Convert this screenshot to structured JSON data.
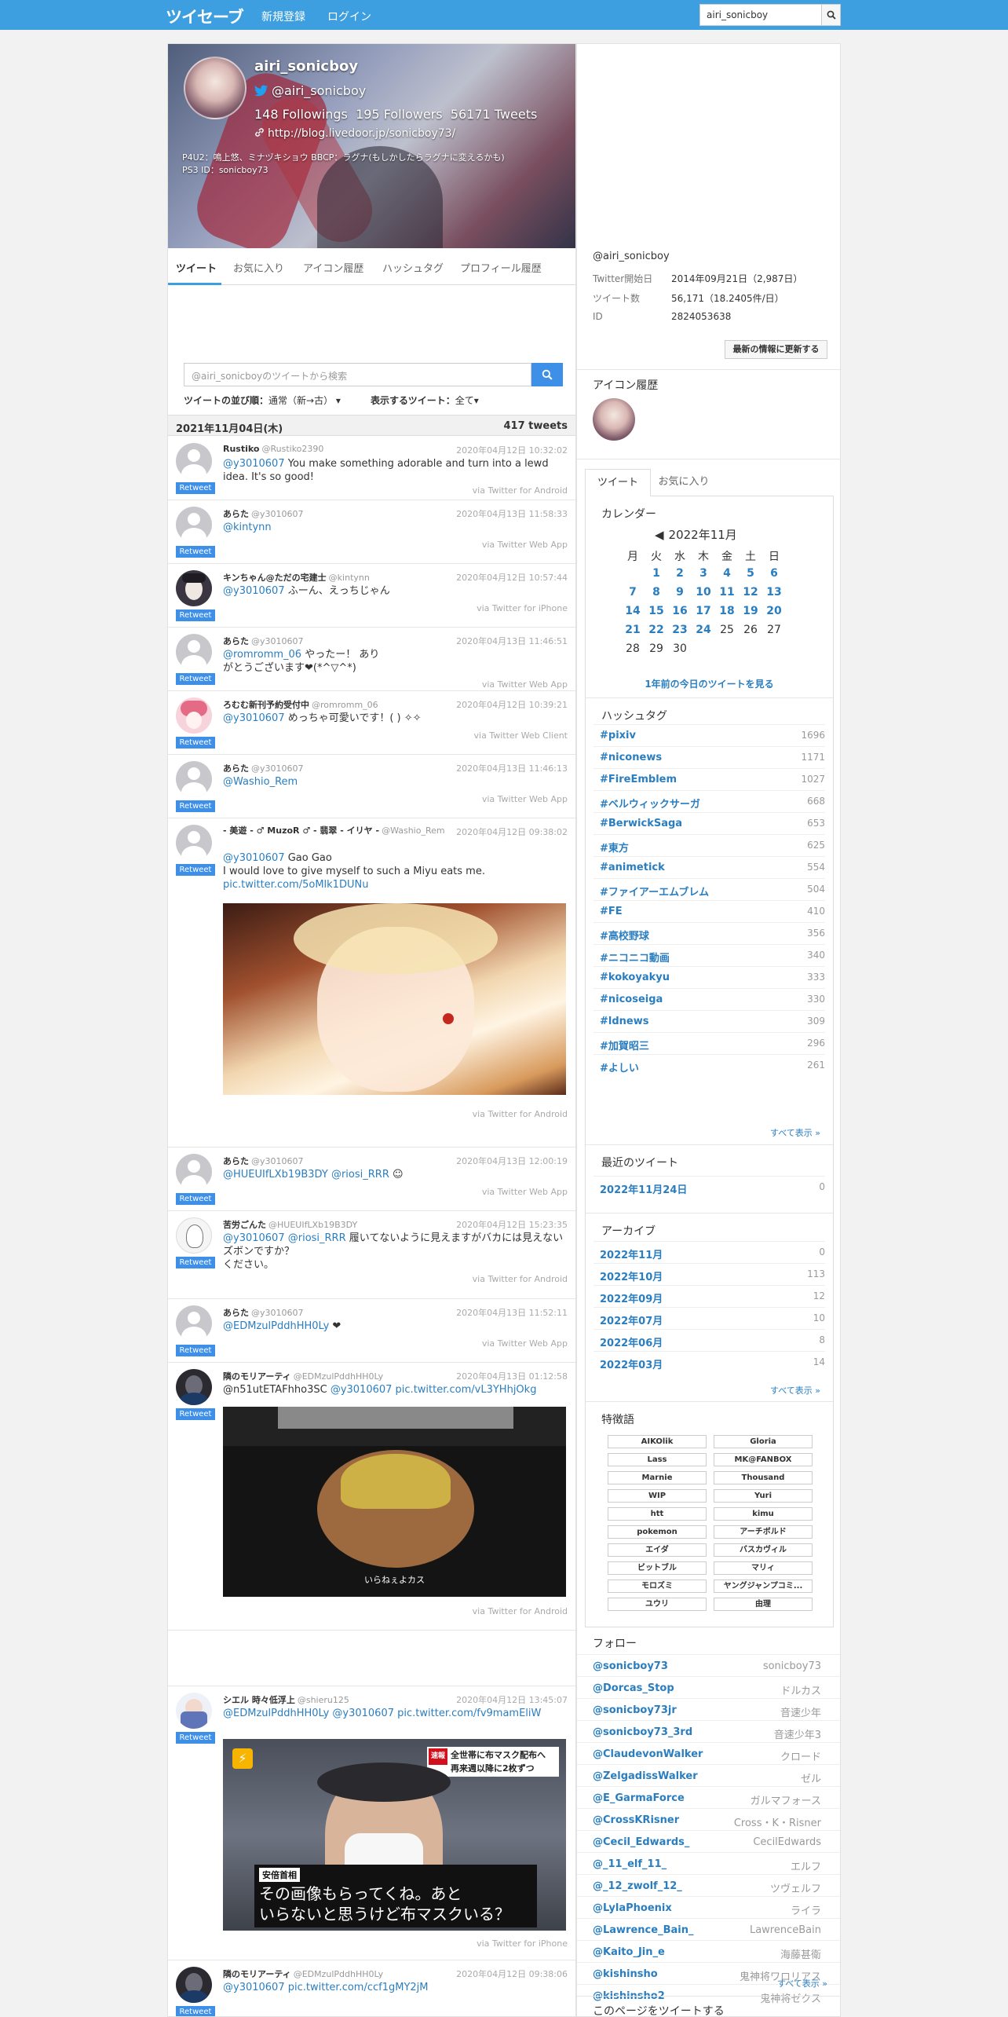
{
  "header": {
    "logo": "ツイセーブ",
    "signup": "新規登録",
    "login": "ログイン",
    "search_value": "airi_sonicboy"
  },
  "profile": {
    "name": "airi_sonicboy",
    "handle": "@airi_sonicboy",
    "stats": "148 Followings  195 Followers  56171 Tweets",
    "url": "http://blog.livedoor.jp/sonicboy73/",
    "bio1": "P4U2：鳴上悠、ミナヅキショウ BBCP：ラグナ(もしかしたらラグナに変えるかも)",
    "bio2": "PS3 ID：sonicboy73"
  },
  "tabs": [
    "ツイート",
    "お気に入り",
    "アイコン履歴",
    "ハッシュタグ",
    "プロフィール履歴"
  ],
  "timeline": {
    "search_placeholder": "@airi_sonicboyのツイートから検索",
    "sort_label": "ツイートの並び順：",
    "sort_value": "通常（新→古）",
    "show_label": "表示するツイート：",
    "show_value": "全て",
    "date": "2021年11月04日(木)",
    "count": "417 tweets"
  },
  "retweet_label": "Retweet",
  "tweets": [
    {
      "name": "Rustiko",
      "sn": "@Rustiko2390",
      "time": "2020年04月12日 10:32:02",
      "link": "@y3010607",
      "text": " You make something adorable and turn into a lewd idea. It's so good!",
      "via": "via Twitter for Android"
    },
    {
      "name": "あらた",
      "sn": "@y3010607",
      "time": "2020年04月13日 11:58:33",
      "link": "@kintynn",
      "text": " ",
      "via": "via Twitter Web App"
    },
    {
      "name": "キンちゃん@ただの宅建士",
      "sn": "@kintynn",
      "time": "2020年04月12日 10:57:44",
      "link": "@y3010607",
      "text": " ふーん、えっちじゃん",
      "via": "via Twitter for iPhone"
    },
    {
      "name": "あらた",
      "sn": "@y3010607",
      "time": "2020年04月13日 11:46:51",
      "link": "@romromm_06",
      "text": " やったー！ ありがとうございます❤(*^▽^*)",
      "via": "via Twitter Web App"
    },
    {
      "name": "ろむむ新刊予約受付中",
      "sn": "@romromm_06",
      "time": "2020年04月12日 10:39:21",
      "link": "@y3010607",
      "text": " めっちゃ可愛いです！( ) ✧✧",
      "via": "via Twitter Web Client"
    },
    {
      "name": "あらた",
      "sn": "@y3010607",
      "time": "2020年04月13日 11:46:13",
      "link": "@Washio_Rem",
      "text": " ",
      "via": "via Twitter Web App"
    },
    {
      "name": "- 美遊 - ♂ MuzoR ♂ - 翡翠 - イリヤ -",
      "sn": "@Washio_Rem",
      "time": "2020年04月12日 09:38:02",
      "link": "@y3010607",
      "text": " Gao Gao",
      "text2": "I would love to give myself to such a Miyu eats me. ",
      "link2": "pic.twitter.com/5oMlk1DUNu",
      "via": "via Twitter for Android"
    },
    {
      "name": "あらた",
      "sn": "@y3010607",
      "time": "2020年04月13日 12:00:19",
      "link": "@HUEUIfLXb19B3DY",
      "link2": "@riosi_RRR",
      "text": " ☺",
      "via": "via Twitter Web App"
    },
    {
      "name": "苦労ごんた",
      "sn": "@HUEUIfLXb19B3DY",
      "time": "2020年04月12日 15:23:35",
      "link": "@y3010607",
      "link2": "@riosi_RRR",
      "text": " 履いてないように見えますがバカには見えないズボンですか？",
      "text2": "ください。",
      "via": "via Twitter for Android"
    },
    {
      "name": "あらた",
      "sn": "@y3010607",
      "time": "2020年04月13日 11:52:11",
      "link": "@EDMzulPddhHH0Ly",
      "text": " ❤",
      "via": "via Twitter Web App"
    },
    {
      "name": "隣のモリアーティ",
      "sn": "@EDMzulPddhHH0Ly",
      "time": "2020年04月13日 01:12:58",
      "text": "@n51utETAFhho3SC ",
      "link": "@y3010607",
      "link2": "pic.twitter.com/vL3YHhjOkg",
      "caption": "いらねぇよカス",
      "via": "via Twitter for Android"
    },
    {
      "name": "シエル 時々低浮上",
      "sn": "@shieru125",
      "time": "2020年04月12日 13:45:07",
      "link": "@EDMzulPddhHH0Ly",
      "link2": "@y3010607",
      "link3": "pic.twitter.com/fv9mamEliW",
      "news_tag": "速報",
      "news_head1": "全世帯に布マスク配布へ",
      "news_head2": "再来週以降に2枚ずつ",
      "news_name": "安倍首相",
      "news_sub1": "その画像もらってくね。あと",
      "news_sub2": "いらないと思うけど布マスクいる？",
      "via": "via Twitter for iPhone"
    },
    {
      "name": "隣のモリアーティ",
      "sn": "@EDMzulPddhHH0Ly",
      "time": "2020年04月12日 09:38:06",
      "link": "@y3010607",
      "link2": "pic.twitter.com/ccf1gMY2jM"
    }
  ],
  "side": {
    "handle": "@airi_sonicboy",
    "info": [
      {
        "k": "Twitter開始日",
        "v": "2014年09月21日（2,987日）"
      },
      {
        "k": "ツイート数",
        "v": "56,171（18.2405件/日）"
      },
      {
        "k": "ID",
        "v": "2824053638"
      }
    ],
    "update_btn": "最新の情報に更新する",
    "icon_title": "アイコン履歴",
    "tabs": [
      "ツイート",
      "お気に入り"
    ],
    "cal_title": "カレンダー",
    "cal_month": "2022年11月",
    "cal_days": [
      "月",
      "火",
      "水",
      "木",
      "金",
      "土",
      "日"
    ],
    "cal_link": "1年前の今日のツイートを見る",
    "hash_title": "ハッシュタグ",
    "hashtags": [
      {
        "k": "#pixiv",
        "v": "1696"
      },
      {
        "k": "#niconews",
        "v": "1171"
      },
      {
        "k": "#FireEmblem",
        "v": "1027"
      },
      {
        "k": "#ベルウィックサーガ",
        "v": "668"
      },
      {
        "k": "#BerwickSaga",
        "v": "653"
      },
      {
        "k": "#東方",
        "v": "625"
      },
      {
        "k": "#animetick",
        "v": "554"
      },
      {
        "k": "#ファイアーエムブレム",
        "v": "504"
      },
      {
        "k": "#FE",
        "v": "410"
      },
      {
        "k": "#高校野球",
        "v": "356"
      },
      {
        "k": "#ニコニコ動画",
        "v": "340"
      },
      {
        "k": "#kokoyakyu",
        "v": "333"
      },
      {
        "k": "#nicoseiga",
        "v": "330"
      },
      {
        "k": "#ldnews",
        "v": "309"
      },
      {
        "k": "#加賀昭三",
        "v": "296"
      },
      {
        "k": "#よしい",
        "v": "261"
      }
    ],
    "more": "すべて表示 »",
    "recent_title": "最近のツイート",
    "recent": [
      {
        "k": "2022年11月24日",
        "v": "0"
      }
    ],
    "archive_title": "アーカイブ",
    "archive": [
      {
        "k": "2022年11月",
        "v": "0"
      },
      {
        "k": "2022年10月",
        "v": "113"
      },
      {
        "k": "2022年09月",
        "v": "12"
      },
      {
        "k": "2022年07月",
        "v": "10"
      },
      {
        "k": "2022年06月",
        "v": "8"
      },
      {
        "k": "2022年03月",
        "v": "14"
      }
    ],
    "kw_title": "特徴語",
    "keywords": [
      "AIKOlik",
      "Gloria",
      "Lass",
      "MK@FANBOX",
      "Marnie",
      "Thousand",
      "WIP",
      "Yuri",
      "htt",
      "kimu",
      "pokemon",
      "アーチボルド",
      "エイダ",
      "バスカヴィル",
      "ビットブル",
      "マリィ",
      "モロズミ",
      "ヤングジャンプコミ...",
      "ユウリ",
      "由理"
    ],
    "follow_title": "フォロー",
    "follows": [
      {
        "k": "@sonicboy73",
        "v": "sonicboy73"
      },
      {
        "k": "@Dorcas_Stop",
        "v": "ドルカス"
      },
      {
        "k": "@sonicboy73jr",
        "v": "音速少年"
      },
      {
        "k": "@sonicboy73_3rd",
        "v": "音速少年3"
      },
      {
        "k": "@ClaudevonWalker",
        "v": "クロード"
      },
      {
        "k": "@ZelgadissWalker",
        "v": "ゼル"
      },
      {
        "k": "@E_GarmaForce",
        "v": "ガルマフォース"
      },
      {
        "k": "@CrossKRisner",
        "v": "Cross・K・Risner"
      },
      {
        "k": "@Cecil_Edwards_",
        "v": "CecilEdwards"
      },
      {
        "k": "@_11_elf_11_",
        "v": "エルフ"
      },
      {
        "k": "@_12_zwolf_12_",
        "v": "ツヴェルフ"
      },
      {
        "k": "@LylaPhoenix",
        "v": "ライラ"
      },
      {
        "k": "@Lawrence_Bain_",
        "v": "LawrenceBain"
      },
      {
        "k": "@Kaito_Jin_e",
        "v": "海藤甚衛"
      },
      {
        "k": "@kishinsho",
        "v": "鬼神将ワロリアス"
      },
      {
        "k": "@kishinsho2",
        "v": "鬼神将ゼクス"
      }
    ],
    "share_title": "このページをツイートする"
  },
  "colors": {
    "accent": "#3d9fe0",
    "link": "#2a7ec0",
    "retweet": "#3d8fe8"
  }
}
